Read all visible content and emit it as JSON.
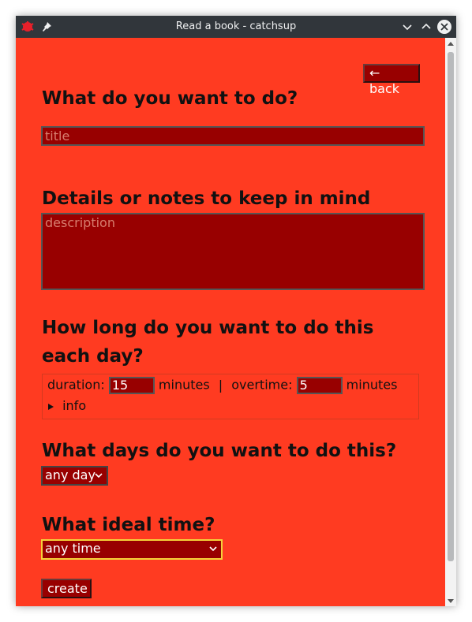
{
  "window": {
    "title": "Read a book - catchsup"
  },
  "nav": {
    "back_label": "← back"
  },
  "form": {
    "title": {
      "heading": "What do you want to do?",
      "placeholder": "title"
    },
    "details": {
      "heading": "Details or notes to keep in mind",
      "placeholder": "description"
    },
    "duration": {
      "heading": "How long do you want to do this each day?",
      "duration_label": "duration:",
      "duration_value": "15",
      "duration_unit": "minutes",
      "separator": "|",
      "overtime_label": "overtime:",
      "overtime_value": "5",
      "overtime_unit": "minutes",
      "info_label": "info"
    },
    "days": {
      "heading": "What days do you want to do this?",
      "selected": "any day"
    },
    "time": {
      "heading": "What ideal time?",
      "selected": "any time"
    },
    "create_label": "create"
  },
  "colors": {
    "background": "#ff3b21",
    "input_bg": "#980000",
    "titlebar": "#31363b"
  }
}
